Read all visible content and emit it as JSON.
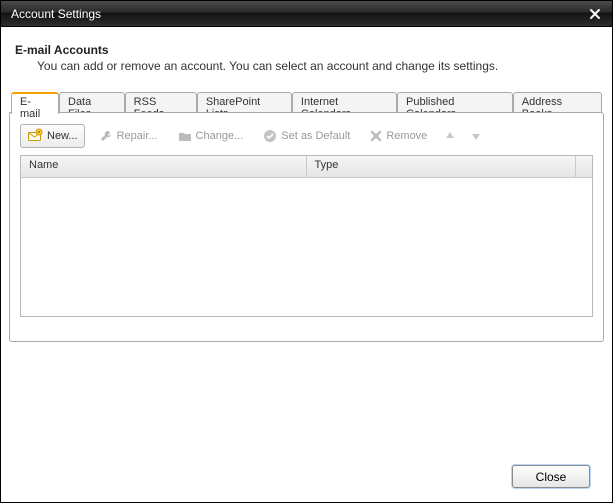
{
  "window": {
    "title": "Account Settings"
  },
  "header": {
    "title": "E-mail Accounts",
    "description": "You can add or remove an account. You can select an account and change its settings."
  },
  "tabs": [
    {
      "label": "E-mail",
      "active": true
    },
    {
      "label": "Data Files"
    },
    {
      "label": "RSS Feeds"
    },
    {
      "label": "SharePoint Lists"
    },
    {
      "label": "Internet Calendars"
    },
    {
      "label": "Published Calendars"
    },
    {
      "label": "Address Books"
    }
  ],
  "toolbar": {
    "new": "New...",
    "repair": "Repair...",
    "change": "Change...",
    "default": "Set as Default",
    "remove": "Remove"
  },
  "columns": {
    "name": "Name",
    "type": "Type"
  },
  "rows": [],
  "footer": {
    "close": "Close"
  }
}
